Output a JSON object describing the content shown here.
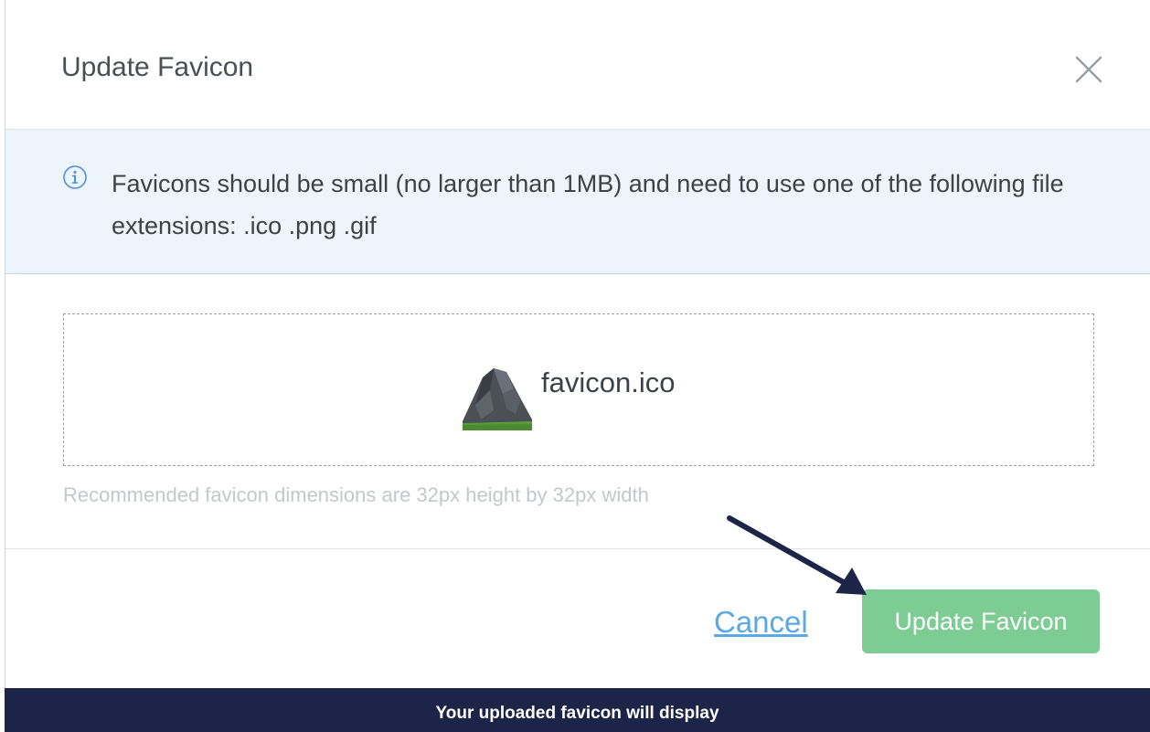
{
  "dialog": {
    "title": "Update Favicon",
    "info_text": "Favicons should be small (no larger than 1MB) and need to use one of the following file extensions: .ico .png .gif",
    "file_name": "favicon.ico",
    "hint": "Recommended favicon dimensions are 32px height by 32px width",
    "cancel_label": "Cancel",
    "submit_label": "Update Favicon"
  },
  "caption": "Your uploaded favicon will display",
  "icons": {
    "close": "close-icon",
    "info": "info-icon",
    "file": "mountain-favicon-icon",
    "annotation": "arrow-annotation"
  },
  "colors": {
    "info_bg": "#eef4fc",
    "info_icon": "#4a90e2",
    "link": "#5aa8e6",
    "submit_bg": "#7dcc94",
    "caption_bg": "#1c2547",
    "arrow": "#1c2547"
  }
}
